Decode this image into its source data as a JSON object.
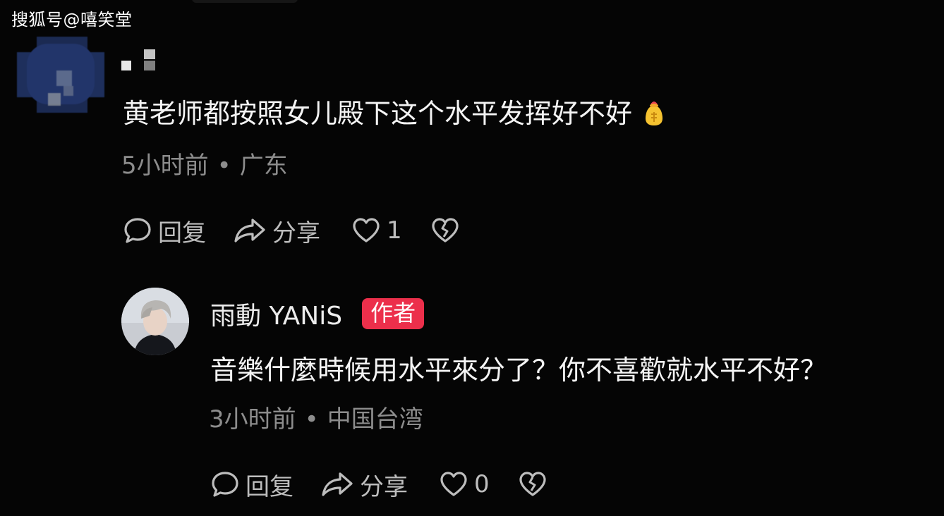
{
  "watermark": "搜狐号@嘻笑堂",
  "comments": [
    {
      "username": "",
      "text": "黄老师都按照女儿殿下这个水平发挥好不好",
      "emoji_icon": "money-bag-icon",
      "time": "5小时前",
      "separator": "•",
      "location": "广东",
      "reply_label": "回复",
      "share_label": "分享",
      "like_count": "1"
    },
    {
      "username": "雨動 YANiS",
      "badge": "作者",
      "text": "音樂什麼時候用水平來分了？你不喜歡就水平不好？",
      "time": "3小时前",
      "separator": "•",
      "location": "中国台湾",
      "reply_label": "回复",
      "share_label": "分享",
      "like_count": "0"
    }
  ],
  "colors": {
    "background": "#050505",
    "badge": "#ec2f4b",
    "meta_text": "#8d8d8d",
    "action_text": "#bdbdbd"
  }
}
